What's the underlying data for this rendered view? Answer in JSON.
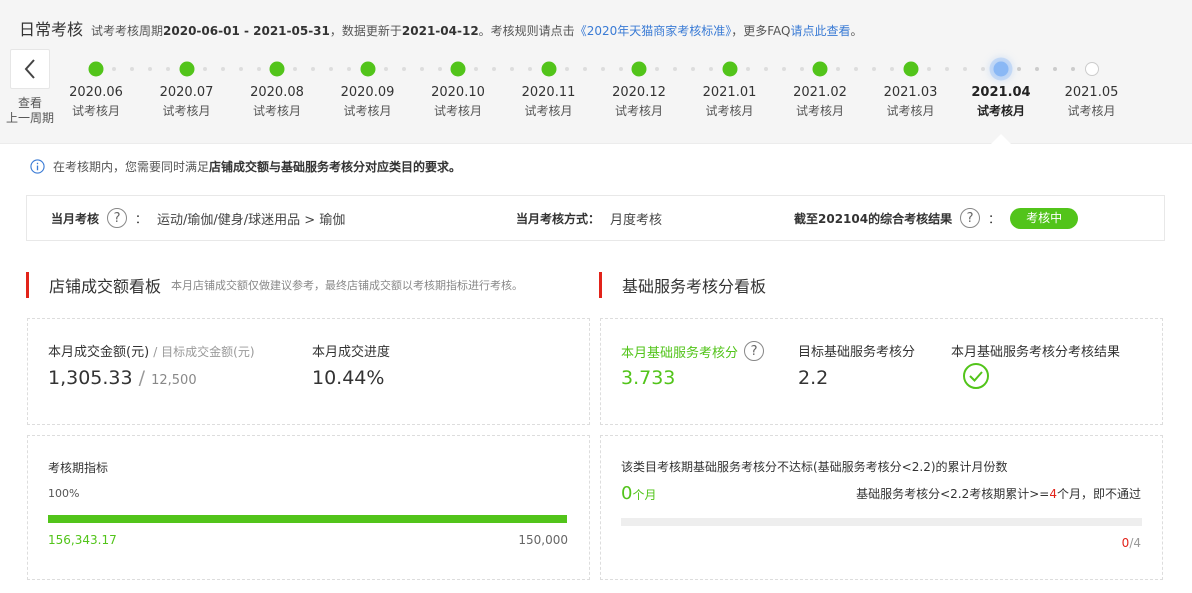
{
  "header": {
    "title": "日常考核",
    "info_prefix": "试考考核周期",
    "period": "2020-06-01 - 2021-05-31",
    "info_updated_prefix": "，数据更新于",
    "updated": "2021-04-12",
    "info_rules_prefix": "。考核规则请点击",
    "rules_link": "《2020年天猫商家考核标准》",
    "info_faq_prefix": "，更多FAQ",
    "faq_link": "请点此查看",
    "info_end": "。"
  },
  "nav": {
    "prev_line1": "查看",
    "prev_line2": "上一周期"
  },
  "timeline": [
    {
      "month": "2020.06",
      "type": "试考核月",
      "state": "done"
    },
    {
      "month": "2020.07",
      "type": "试考核月",
      "state": "done"
    },
    {
      "month": "2020.08",
      "type": "试考核月",
      "state": "done"
    },
    {
      "month": "2020.09",
      "type": "试考核月",
      "state": "done"
    },
    {
      "month": "2020.10",
      "type": "试考核月",
      "state": "done"
    },
    {
      "month": "2020.11",
      "type": "试考核月",
      "state": "done"
    },
    {
      "month": "2020.12",
      "type": "试考核月",
      "state": "done"
    },
    {
      "month": "2021.01",
      "type": "试考核月",
      "state": "done"
    },
    {
      "month": "2021.02",
      "type": "试考核月",
      "state": "done"
    },
    {
      "month": "2021.03",
      "type": "试考核月",
      "state": "done"
    },
    {
      "month": "2021.04",
      "type": "试考核月",
      "state": "current"
    },
    {
      "month": "2021.05",
      "type": "试考核月",
      "state": "future"
    }
  ],
  "tip": {
    "prefix": "在考核期内，您需要同时满足",
    "bold": "店铺成交额与基础服务考核分对应类目的要求。"
  },
  "summary": {
    "month_label": "当月考核",
    "category": "运动/瑜伽/健身/球迷用品 > 瑜伽",
    "method_label": "当月考核方式：",
    "method_value": "月度考核",
    "result_label": "截至202104的综合考核结果",
    "result_badge": "考核中"
  },
  "left_section": {
    "title": "店铺成交额看板",
    "note": "本月店铺成交额仅做建议参考，最终店铺成交额以考核期指标进行考核。",
    "amount_label": "本月成交金额(元)",
    "target_label": "/ 目标成交金额(元)",
    "amount_value": "1,305.33",
    "target_value": "12,500",
    "progress_label": "本月成交进度",
    "progress_value": "10.44%",
    "period_label": "考核期指标",
    "period_percent": "100%",
    "period_fill": 1.0,
    "period_actual": "156,343.17",
    "period_target": "150,000"
  },
  "right_section": {
    "title": "基础服务考核分看板",
    "score_label": "本月基础服务考核分",
    "score_value": "3.733",
    "target_label": "目标基础服务考核分",
    "target_value": "2.2",
    "result_label": "本月基础服务考核分考核结果",
    "fail_desc": "该类目考核期基础服务考核分不达标(基础服务考核分<2.2)的累计月份数",
    "fail_count": "0",
    "fail_unit": "个月",
    "rule_prefix": "基础服务考核分<2.2考核期累计>=",
    "rule_limit": "4",
    "rule_suffix": "个月，即不通过",
    "ratio_num": "0",
    "ratio_den": "/4",
    "fail_fill": 0
  },
  "colors": {
    "green": "#52c41a",
    "red": "#e2231a",
    "link": "#3a7bd5",
    "current": "#8ab8f5"
  }
}
